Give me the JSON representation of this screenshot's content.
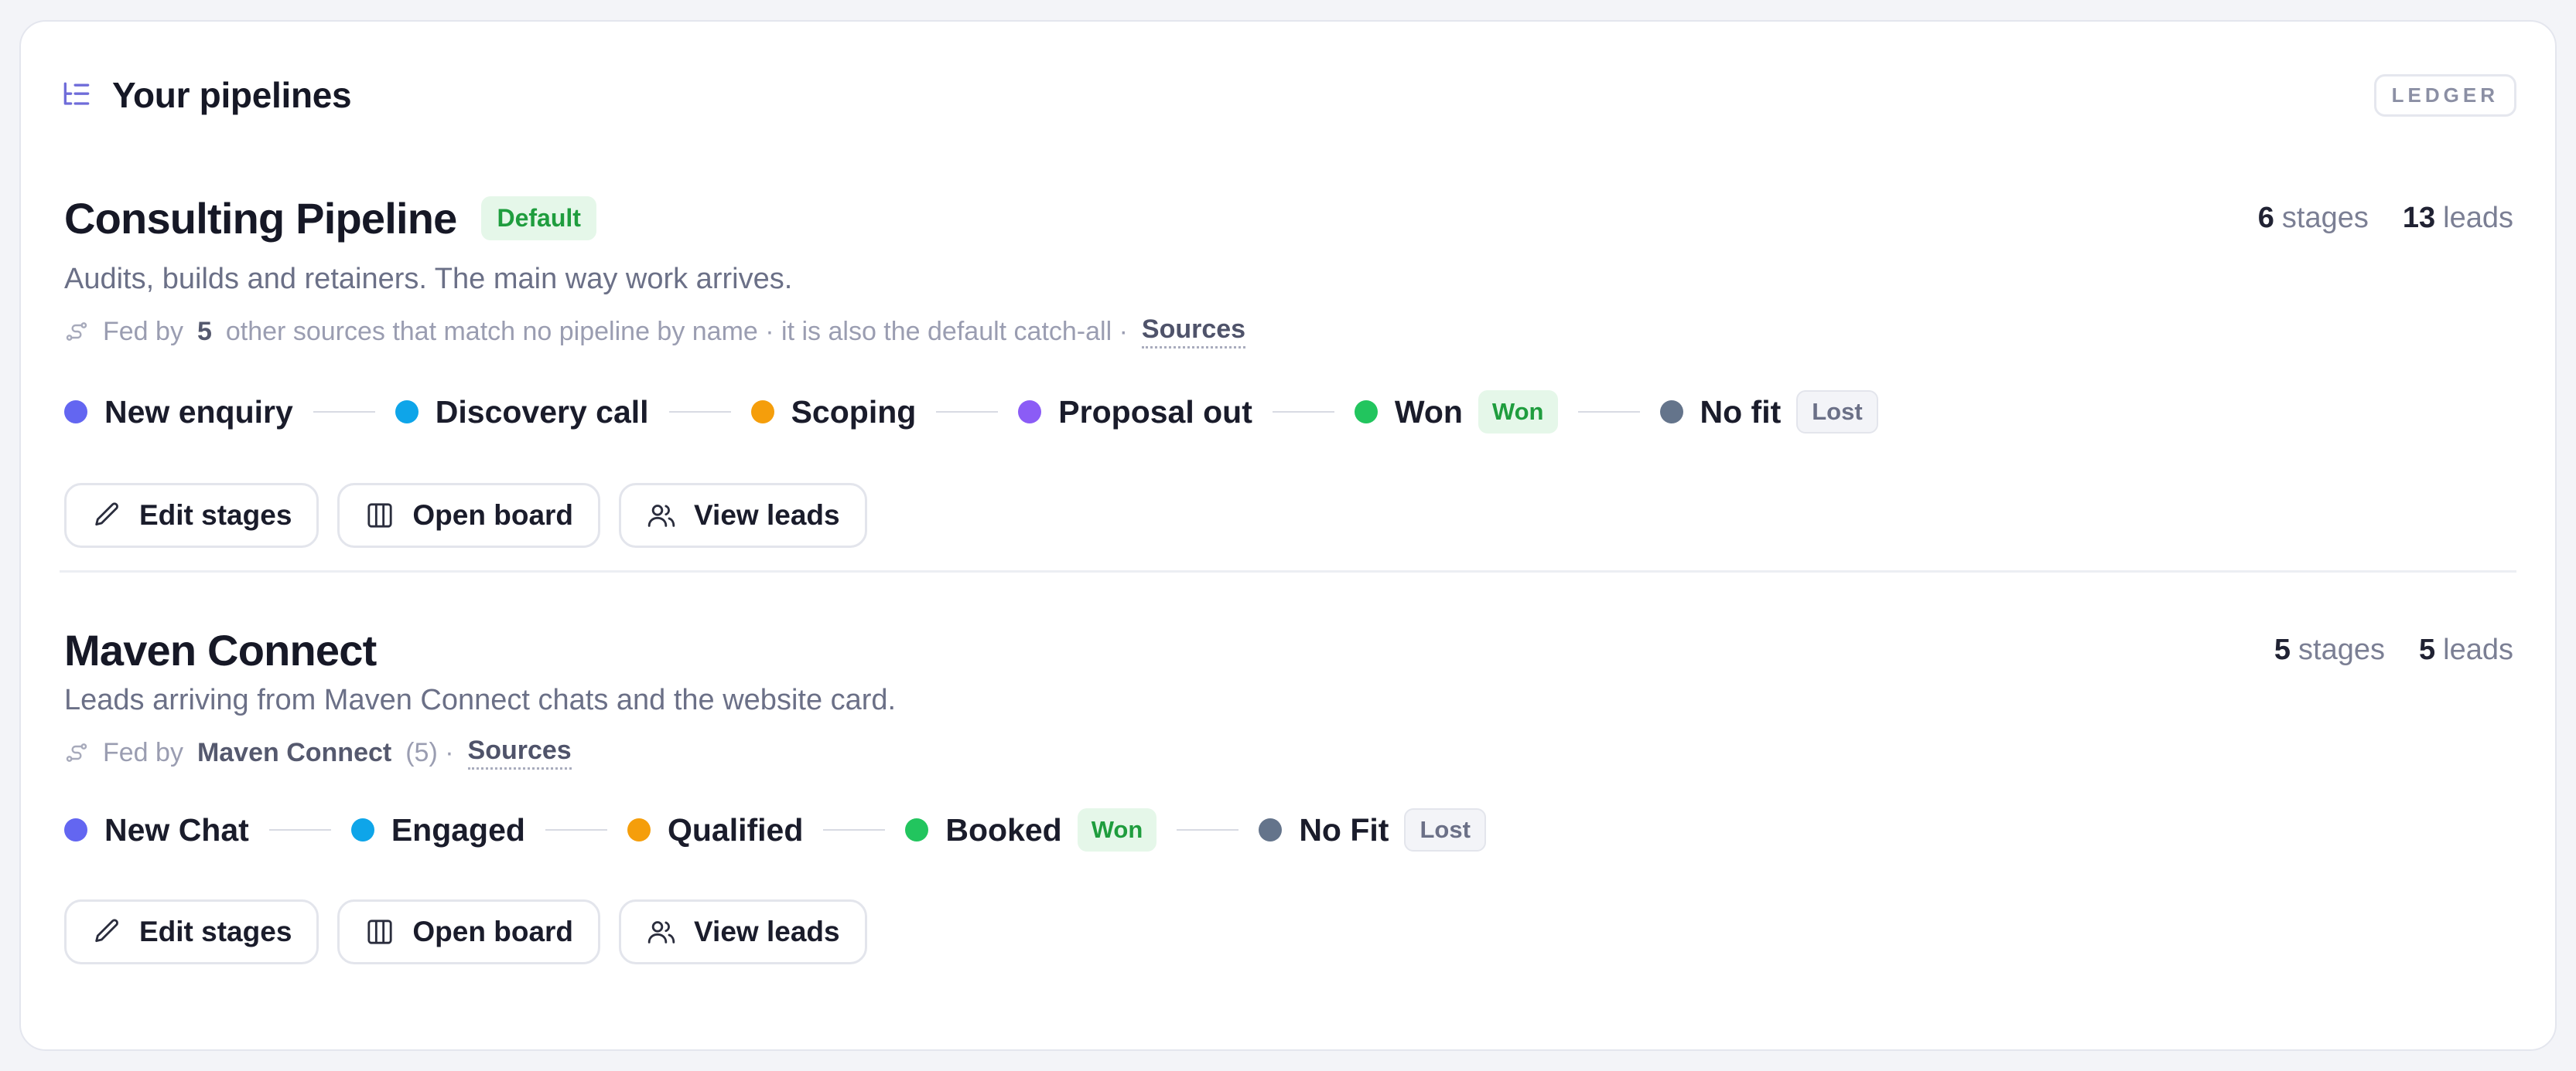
{
  "header": {
    "title": "Your pipelines",
    "badge": "LEDGER"
  },
  "colors": {
    "indigo": "#6366f1",
    "sky": "#0ea5e9",
    "amber": "#f59e0b",
    "violet": "#8b5cf6",
    "green": "#22c55e",
    "slate": "#64748b"
  },
  "pipelines": [
    {
      "name": "Consulting Pipeline",
      "default_badge": "Default",
      "stages_count": "6",
      "stages_word": "stages",
      "leads_count": "13",
      "leads_word": "leads",
      "description": "Audits, builds and retainers. The main way work arrives.",
      "fed_prefix": "Fed by",
      "fed_value": "5",
      "fed_suffix": "other sources that match no pipeline by name · it is also the default catch-all ·",
      "sources_link": "Sources",
      "stages": [
        {
          "label": "New enquiry",
          "color": "#6366f1"
        },
        {
          "label": "Discovery call",
          "color": "#0ea5e9"
        },
        {
          "label": "Scoping",
          "color": "#f59e0b"
        },
        {
          "label": "Proposal out",
          "color": "#8b5cf6"
        },
        {
          "label": "Won",
          "color": "#22c55e",
          "badge": "Won"
        },
        {
          "label": "No fit",
          "color": "#64748b",
          "badge": "Lost"
        }
      ],
      "actions": {
        "edit": "Edit stages",
        "board": "Open board",
        "leads": "View leads"
      }
    },
    {
      "name": "Maven Connect",
      "stages_count": "5",
      "stages_word": "stages",
      "leads_count": "5",
      "leads_word": "leads",
      "description": "Leads arriving from Maven Connect chats and the website card.",
      "fed_prefix": "Fed by",
      "fed_value": "Maven Connect",
      "fed_count": "(5) ·",
      "sources_link": "Sources",
      "stages": [
        {
          "label": "New Chat",
          "color": "#6366f1"
        },
        {
          "label": "Engaged",
          "color": "#0ea5e9"
        },
        {
          "label": "Qualified",
          "color": "#f59e0b"
        },
        {
          "label": "Booked",
          "color": "#22c55e",
          "badge": "Won"
        },
        {
          "label": "No Fit",
          "color": "#64748b",
          "badge": "Lost"
        }
      ],
      "actions": {
        "edit": "Edit stages",
        "board": "Open board",
        "leads": "View leads"
      }
    }
  ]
}
